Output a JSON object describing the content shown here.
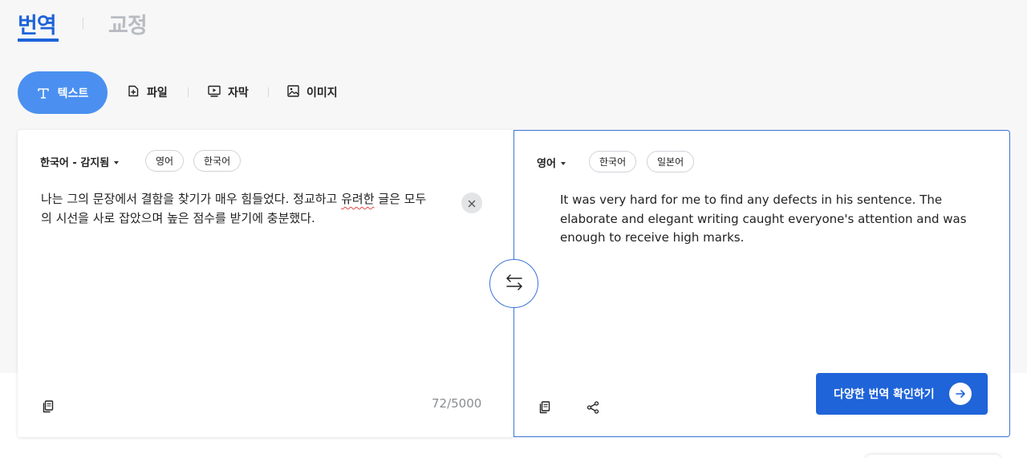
{
  "main_tabs": {
    "translate": "번역",
    "proofread": "교정"
  },
  "mode_tabs": {
    "text": "텍스트",
    "file": "파일",
    "subtitle": "자막",
    "image": "이미지"
  },
  "source_panel": {
    "language": "한국어 - 감지됨",
    "quick_langs": [
      "영어",
      "한국어"
    ],
    "text_before_error": "나는 그의 문장에서 결함을 찾기가 매우 힘들었다. 정교하고 ",
    "text_error": "유려한",
    "text_after_error": " 글은 모두의 시선을 사로 잡았으며 높은 점수를 받기에 충분했다.",
    "char_count": "72/5000"
  },
  "target_panel": {
    "language": "영어",
    "quick_langs": [
      "한국어",
      "일본어"
    ],
    "text": "It was very hard for me to find any defects in his sentence. The elaborate and elegant writing caught everyone's attention and was enough to receive high marks.",
    "more_button": "다양한 번역 확인하기"
  },
  "colors": {
    "accent": "#1f64d8",
    "text_mode_button": "#4b90f0"
  }
}
